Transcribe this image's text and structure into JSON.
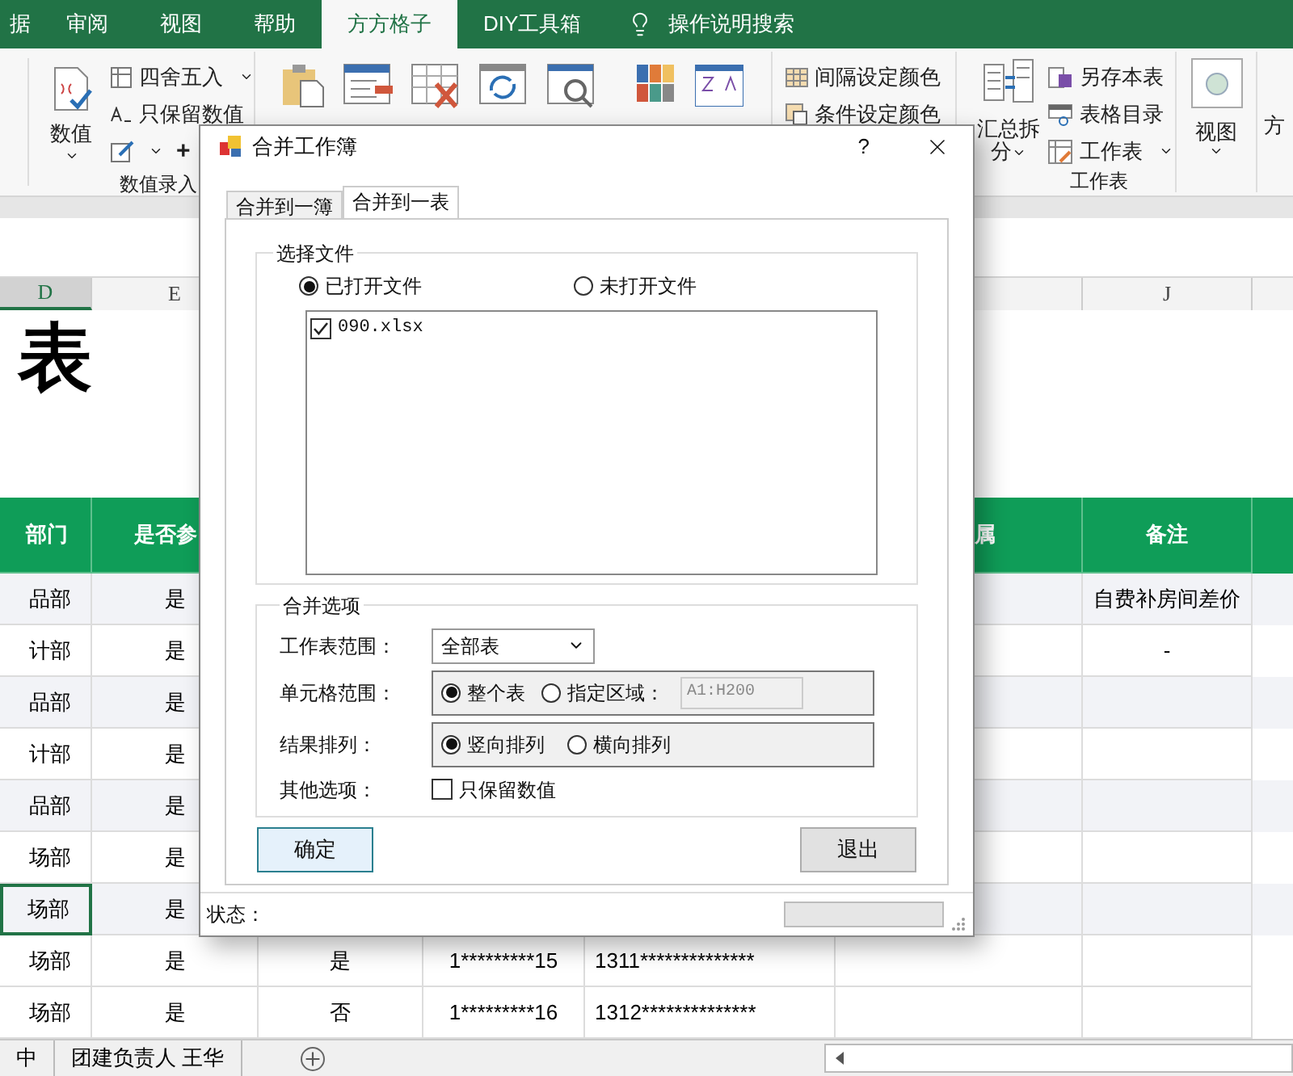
{
  "ribbon_tabs": [
    {
      "label": "据",
      "selected": false
    },
    {
      "label": "审阅",
      "selected": false
    },
    {
      "label": "视图",
      "selected": false
    },
    {
      "label": "帮助",
      "selected": false
    },
    {
      "label": "方方格子",
      "selected": true
    },
    {
      "label": "DIY工具箱",
      "selected": false
    }
  ],
  "tell_me": {
    "label": "操作说明搜索"
  },
  "ribbon": {
    "value_button": "数值",
    "round_button": "四舍五入",
    "keep_values_button": "只保留数值",
    "plus_button": "+",
    "value_group_label": "数值录入",
    "interval_color_button": "间隔设定颜色",
    "condition_color_button": "条件设定颜色",
    "split_button": [
      "汇总拆",
      "分"
    ],
    "save_sheet_button": "另存本表",
    "table_index_button": "表格目录",
    "worksheet_button": "工作表",
    "worksheet_group_label": "工作表",
    "view_button": "视图",
    "cut_button": "方"
  },
  "sheet": {
    "column_headers": {
      "d": {
        "label": "D",
        "selected": true
      },
      "e": {
        "label": "E",
        "selected": false
      },
      "j": {
        "label": "J",
        "selected": false
      }
    },
    "title": "表",
    "header": {
      "d": "部门",
      "e": "是否参",
      "i": "属",
      "j": "备注"
    },
    "rows": [
      {
        "d": "品部",
        "e": "是",
        "j": "自费补房间差价",
        "selected": false
      },
      {
        "d": "计部",
        "e": "是",
        "j": "-",
        "selected": false
      },
      {
        "d": "品部",
        "e": "是",
        "selected": false
      },
      {
        "d": "计部",
        "e": "是",
        "selected": false
      },
      {
        "d": "品部",
        "e": "是",
        "selected": false
      },
      {
        "d": "场部",
        "e": "是",
        "selected": false
      },
      {
        "d": "场部",
        "e": "是",
        "selected": true
      },
      {
        "d": "场部",
        "e": "是",
        "f": "是",
        "g": "1*********15",
        "h": "1311**************",
        "selected": false
      },
      {
        "d": "场部",
        "e": "是",
        "f": "否",
        "g": "1*********16",
        "h": "1312**************",
        "selected": false
      }
    ],
    "sheet_tabs": [
      {
        "label": "中",
        "selected": false
      },
      {
        "label": "团建负责人 王华",
        "selected": false
      }
    ]
  },
  "dialog": {
    "title": "合并工作簿",
    "help": "?",
    "tabs": [
      {
        "label": "合并到一簿",
        "selected": false
      },
      {
        "label": "合并到一表",
        "selected": true
      }
    ],
    "file_group": {
      "title": "选择文件",
      "sources": [
        {
          "label": "已打开文件",
          "selected": true
        },
        {
          "label": "未打开文件",
          "selected": false
        }
      ],
      "files": [
        {
          "name": "090.xlsx",
          "checked": true
        }
      ]
    },
    "options_group": {
      "title": "合并选项",
      "sheet_range": {
        "label": "工作表范围：",
        "value": "全部表"
      },
      "cell_range": {
        "label": "单元格范围：",
        "options": [
          {
            "label": "整个表",
            "selected": true
          },
          {
            "label": "指定区域：",
            "selected": false
          }
        ],
        "area": {
          "value": "A1:H200",
          "disabled": true
        }
      },
      "arrange": {
        "label": "结果排列：",
        "options": [
          {
            "label": "竖向排列",
            "selected": true
          },
          {
            "label": "横向排列",
            "selected": false
          }
        ]
      },
      "other": {
        "label": "其他选项：",
        "checkbox": {
          "label": "只保留数值",
          "checked": false
        }
      }
    },
    "buttons": [
      {
        "label": "确定",
        "focused": true
      },
      {
        "label": "退出",
        "focused": false
      }
    ],
    "status": {
      "label": "状态：",
      "level": 0
    }
  }
}
